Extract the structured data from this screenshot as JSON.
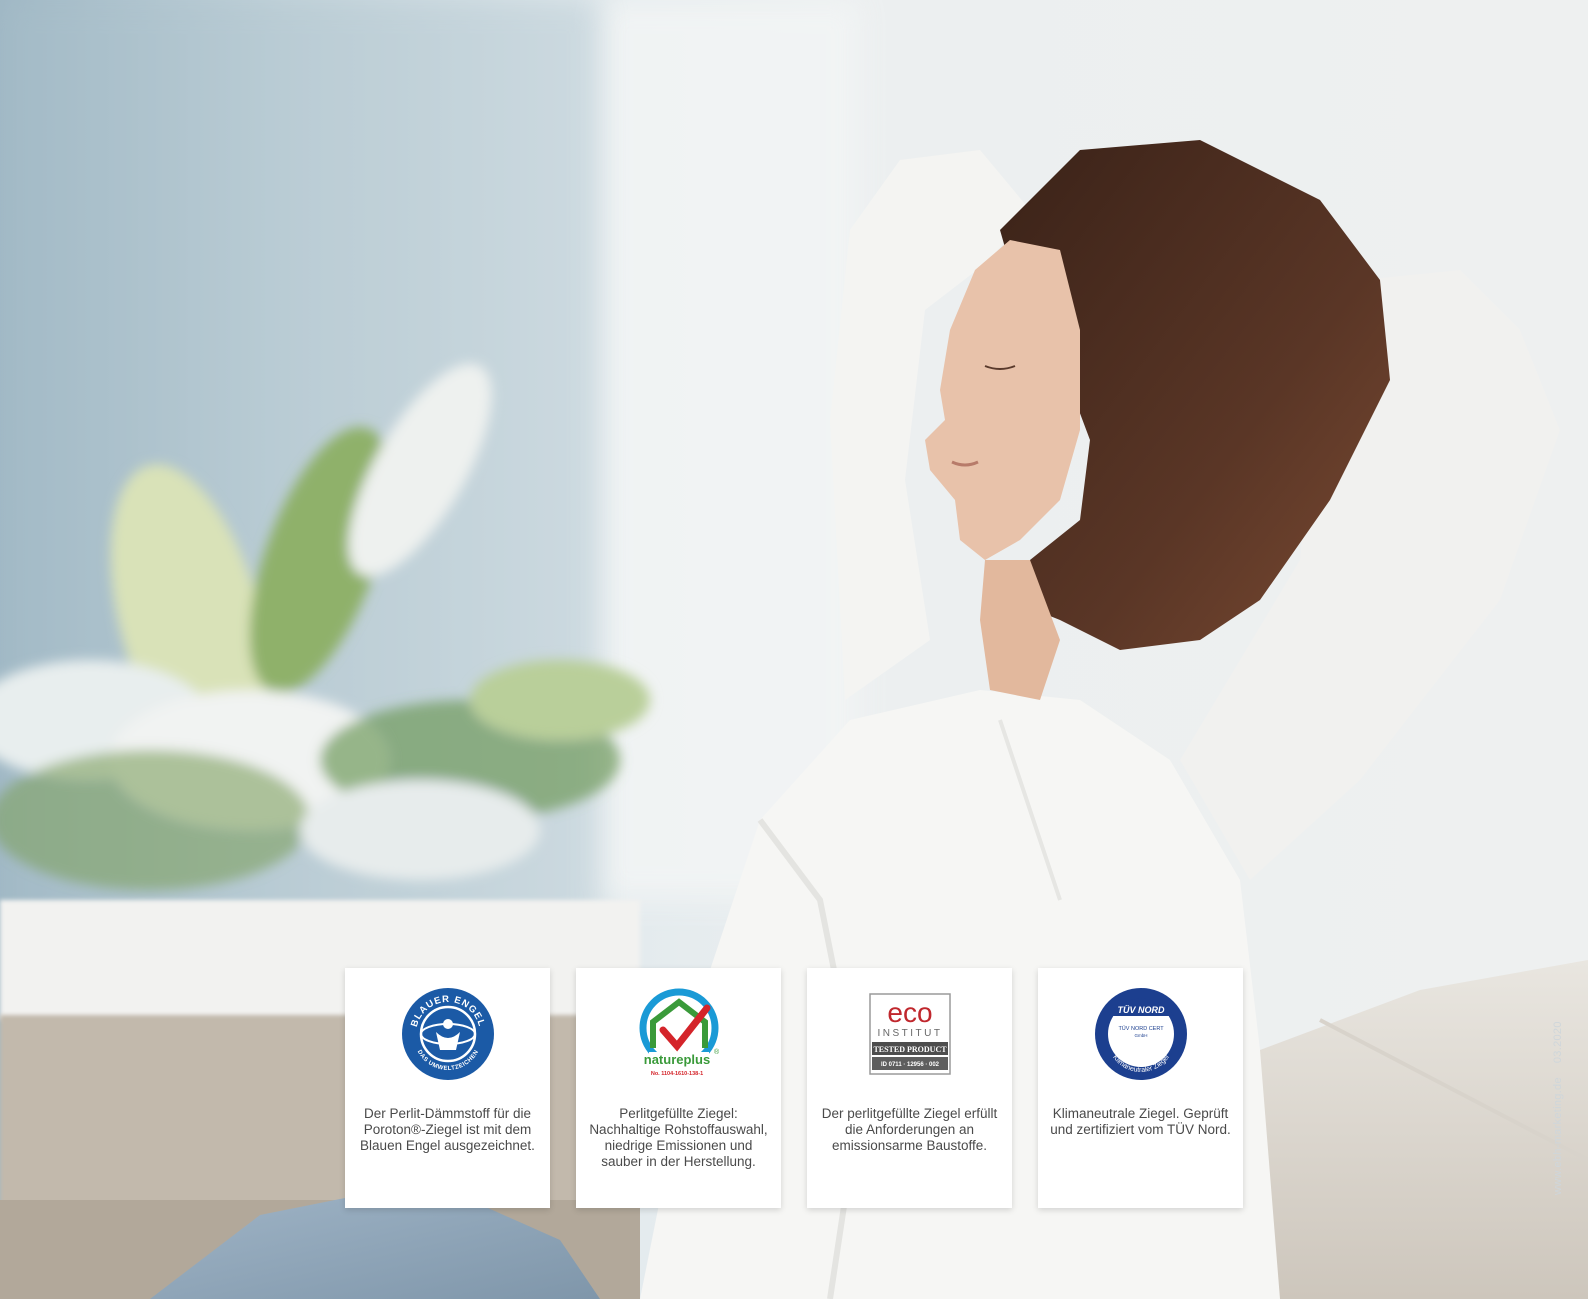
{
  "badges": [
    {
      "logo": "blauer-engel-logo",
      "logo_text": [
        "BLAUER ENGEL",
        "DAS UMWELTZEICHEN"
      ],
      "caption": "Der Perlit-Dämmstoff für die Poroton®-Ziegel ist mit dem Blauen Engel ausgezeichnet."
    },
    {
      "logo": "natureplus-logo",
      "logo_text": [
        "natureplus",
        "®",
        "No. 1104-1610-138-1"
      ],
      "caption": "Perlitgefüllte Ziegel: Nachhaltige Rohstoffauswahl, niedrige Emissionen und sauber in der Herstellung."
    },
    {
      "logo": "eco-institut-logo",
      "logo_text": [
        "eco",
        "INSTITUT",
        "TESTED PRODUCT",
        "ID 0711 · 12956 · 002"
      ],
      "caption": "Der perlitgefüllte Ziegel erfüllt die Anforderungen an emissionsarme Baustoffe."
    },
    {
      "logo": "tuev-nord-logo",
      "logo_text": [
        "TÜV NORD",
        "TÜV NORD CERT",
        "GmbH",
        "Klimaneutraler Ziegel"
      ],
      "caption": "Klimaneutrale Ziegel. Geprüft und zertifiziert vom TÜV Nord."
    }
  ],
  "imprint": {
    "website": "www.ebh-marketing.de",
    "date": "03.2020"
  },
  "colors": {
    "blauer_engel_blue": "#1b5aa6",
    "natureplus_green": "#3a9a3a",
    "natureplus_red": "#d4242a",
    "eco_red": "#c0272d",
    "tuev_blue": "#1c3f8f"
  }
}
